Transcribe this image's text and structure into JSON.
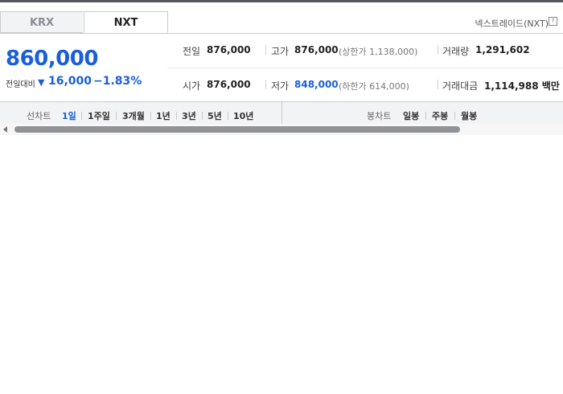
{
  "market_tabs": [
    {
      "label": "KRX",
      "active": false
    },
    {
      "label": "NXT",
      "active": true
    }
  ],
  "header": {
    "info_label": "넥스트레이드(NXT)",
    "help_icon": "?"
  },
  "quote": {
    "price": "860,000",
    "change_label": "전일대비",
    "change_arrow": "▼",
    "change_value": "16,000",
    "change_percent": "−1.83%"
  },
  "stats": {
    "prev_close": {
      "label": "전일",
      "value": "876,000"
    },
    "high": {
      "label": "고가",
      "value": "876,000",
      "sub": "(상한가 1,138,000)"
    },
    "volume": {
      "label": "거래량",
      "value": "1,291,602"
    },
    "open": {
      "label": "시가",
      "value": "876,000"
    },
    "low": {
      "label": "저가",
      "value": "848,000",
      "sub": "(하한가 614,000)"
    },
    "trade_value": {
      "label": "거래대금",
      "value": "1,114,988 백만"
    }
  },
  "chart_toolbar": {
    "line_chart_label": "선차트",
    "line_periods": [
      "1일",
      "1주일",
      "3개월",
      "1년",
      "3년",
      "5년",
      "10년"
    ],
    "active_period": "1일",
    "candle_chart_label": "봉차트",
    "candle_periods": [
      "일봉",
      "주봉",
      "월봉"
    ]
  },
  "colors": {
    "accent_blue": "#1a5fd9",
    "toolbar_bg": "#f2f3f5",
    "border": "#c9cbd0"
  }
}
